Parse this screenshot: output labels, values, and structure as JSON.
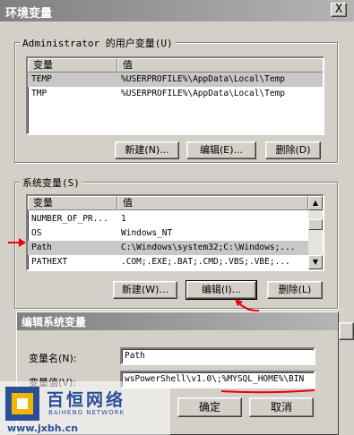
{
  "window": {
    "title": "环境变量",
    "close_glyph": "X"
  },
  "user_vars": {
    "legend": "Administrator 的用户变量(U)",
    "col_var": "变量",
    "col_val": "值",
    "rows": [
      {
        "name": "TEMP",
        "value": "%USERPROFILE%\\AppData\\Local\\Temp",
        "selected": true
      },
      {
        "name": "TMP",
        "value": "%USERPROFILE%\\AppData\\Local\\Temp",
        "selected": false
      }
    ],
    "buttons": {
      "new": "新建(N)...",
      "edit": "编辑(E)...",
      "delete": "删除(D)"
    }
  },
  "sys_vars": {
    "legend": "系统变量(S)",
    "col_var": "变量",
    "col_val": "值",
    "rows": [
      {
        "name": "NUMBER_OF_PR...",
        "value": "1",
        "selected": false
      },
      {
        "name": "OS",
        "value": "Windows_NT",
        "selected": false
      },
      {
        "name": "Path",
        "value": "C:\\Windows\\system32;C:\\Windows;...",
        "selected": true
      },
      {
        "name": "PATHEXT",
        "value": ".COM;.EXE;.BAT;.CMD;.VBS;.VBE;...",
        "selected": false
      }
    ],
    "buttons": {
      "new": "新建(W)...",
      "edit": "编辑(I)...",
      "delete": "删除(L)"
    }
  },
  "edit_dialog": {
    "title": "编辑系统变量",
    "name_label": "变量名(N):",
    "name_value": "Path",
    "value_label": "变量值(V):",
    "value_value": "wsPowerShell\\v1.0\\;%MYSQL_HOME%\\BIN",
    "ok": "确定",
    "cancel": "取消"
  },
  "watermark": {
    "brand": "百恒网络",
    "brand_en": "BAIHENG NETWORK",
    "url": "www.jxbh.cn"
  },
  "colors": {
    "annotation": "#e8000c",
    "brand_blue": "#2a4f9a",
    "brand_yellow": "#f1b700"
  }
}
